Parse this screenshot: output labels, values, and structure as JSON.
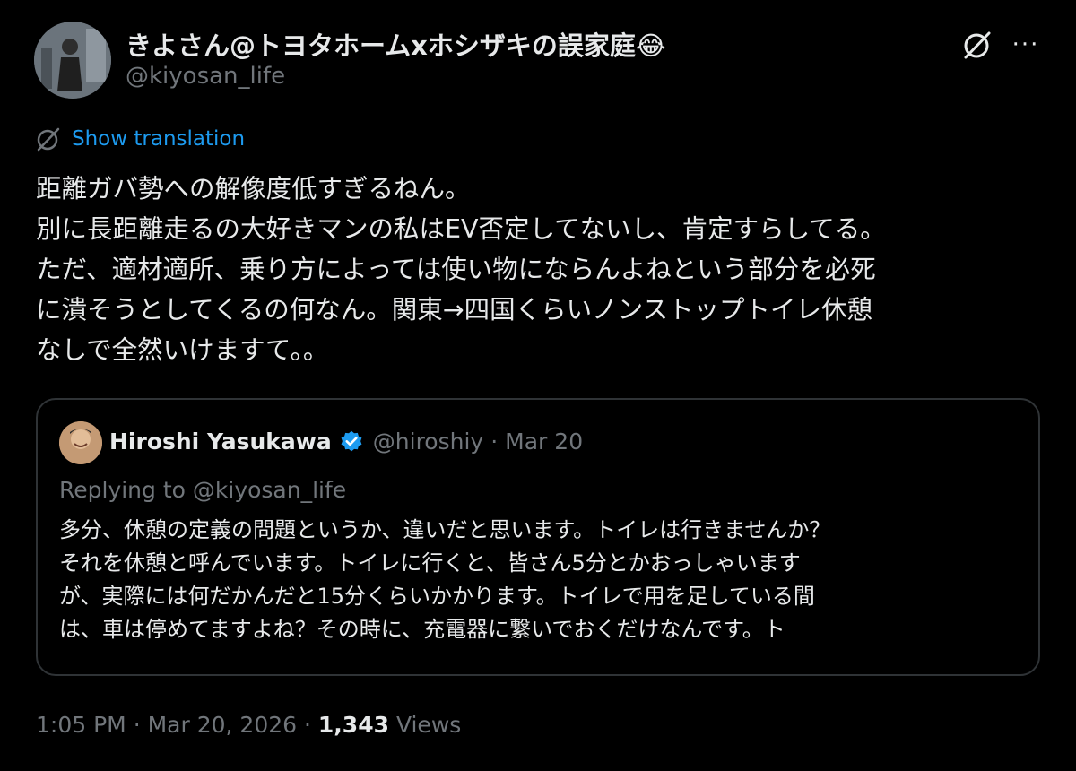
{
  "author": {
    "display_name": "きよさん@トヨタホームxホシザキの誤家庭😂",
    "handle": "@kiyosan_life",
    "avatar_icon": "user-avatar"
  },
  "header_actions": {
    "grok_icon": "grok-icon",
    "more_icon": "more-options-icon",
    "more_glyph": "···"
  },
  "translation": {
    "label": "Show translation",
    "icon": "translate-icon"
  },
  "tweet": {
    "lines": [
      "距離ガバ勢への解像度低すぎるねん。",
      "別に長距離走るの大好きマンの私はEV否定してないし、肯定すらしてる。",
      "ただ、適材適所、乗り方によっては使い物にならんよねという部分を必死",
      "に潰そうとしてくるの何なん。関東→四国くらいノンストップトイレ休憩",
      "なしで全然いけますて。。"
    ]
  },
  "quote": {
    "name": "Hiroshi Yasukawa",
    "verified_icon": "verified-badge-icon",
    "handle": "@hiroshiy",
    "separator": "·",
    "date": "Mar 20",
    "replying_to": "Replying to @kiyosan_life",
    "lines": [
      "多分、休憩の定義の問題というか、違いだと思います。トイレは行きませんか？",
      "それを休憩と呼んでいます。トイレに行くと、皆さん5分とかおっしゃいます",
      "が、実際には何だかんだと15分くらいかかります。トイレで用を足している間",
      "は、車は停めてますよね？その時に、充電器に繋いでおくだけなんです。ト"
    ]
  },
  "meta": {
    "time": "1:05 PM",
    "separator": "·",
    "date": "Mar 20, 2026",
    "separator2": "·",
    "views_count": "1,343",
    "views_label": "Views"
  },
  "colors": {
    "background": "#000000",
    "text_primary": "#e7e9ea",
    "text_secondary": "#71767b",
    "link": "#1d9bf0",
    "border": "#2f3336"
  }
}
